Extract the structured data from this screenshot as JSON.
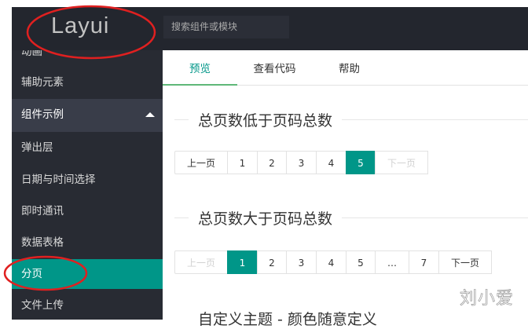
{
  "header": {
    "logo": "Layui",
    "search_placeholder": "搜索组件或模块"
  },
  "sidebar": {
    "items": [
      "动画",
      "辅助元素",
      "组件示例",
      "弹出层",
      "日期与时间选择",
      "即时通讯",
      "数据表格",
      "分页",
      "文件上传"
    ]
  },
  "tabs": [
    "预览",
    "查看代码",
    "帮助"
  ],
  "sections": [
    {
      "title": "总页数低于页码总数",
      "pager": [
        "上一页",
        "1",
        "2",
        "3",
        "4",
        "5",
        "下一页"
      ]
    },
    {
      "title": "总页数大于页码总数",
      "pager": [
        "上一页",
        "1",
        "2",
        "3",
        "4",
        "5",
        "…",
        "7",
        "下一页"
      ]
    },
    {
      "title": "自定义主题 - 颜色随意定义"
    }
  ],
  "watermark": "刘小爱",
  "colors": {
    "accent": "#009688",
    "header": "#23262e",
    "annotation": "#e02020"
  }
}
